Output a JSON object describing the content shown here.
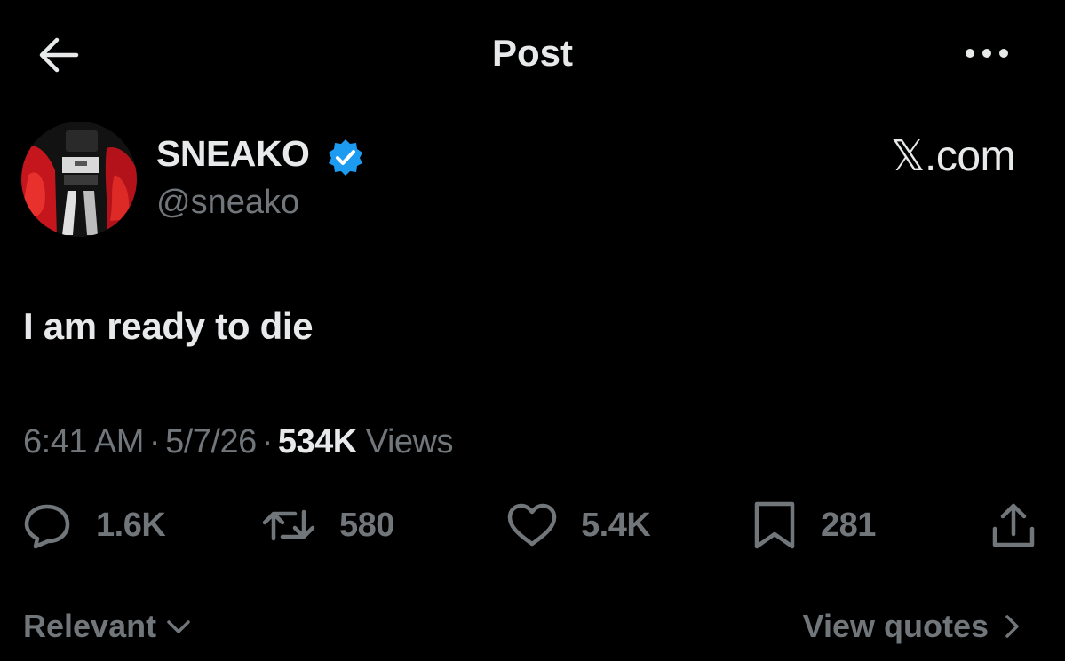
{
  "header": {
    "title": "Post"
  },
  "author": {
    "display_name": "SNEAKO",
    "handle": "@sneako",
    "verified": true
  },
  "watermark": "𝕏.com",
  "post": {
    "text": "I am ready to die",
    "time": "6:41 AM",
    "date": "5/7/26",
    "views_count": "534K",
    "views_label": "Views"
  },
  "actions": {
    "replies": "1.6K",
    "reposts": "580",
    "likes": "5.4K",
    "bookmarks": "281"
  },
  "footer": {
    "sort_label": "Relevant",
    "quotes_label": "View quotes"
  },
  "colors": {
    "background": "#000000",
    "primary_text": "#e7e9ea",
    "secondary_text": "#71767b",
    "verified_blue": "#1d9bf0"
  },
  "icons": [
    "arrow-left-icon",
    "ellipsis-icon",
    "verified-badge-icon",
    "reply-icon",
    "repost-icon",
    "heart-icon",
    "bookmark-icon",
    "share-icon",
    "chevron-down-icon",
    "chevron-right-icon"
  ]
}
